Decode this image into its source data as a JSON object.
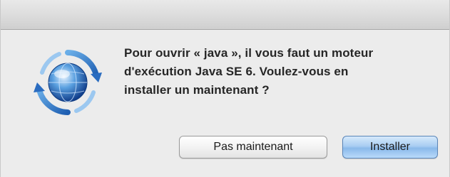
{
  "dialog": {
    "message_line1": "Pour ouvrir « java », il vous faut un moteur",
    "message_line2": "d'exécution Java SE 6. Voulez-vous en",
    "message_line3": "installer un maintenant ?",
    "icon": "software-update-icon"
  },
  "buttons": {
    "secondary_label": "Pas maintenant",
    "primary_label": "Installer"
  },
  "colors": {
    "accent": "#8ab9ea",
    "text": "#262626",
    "background": "#ececec"
  }
}
